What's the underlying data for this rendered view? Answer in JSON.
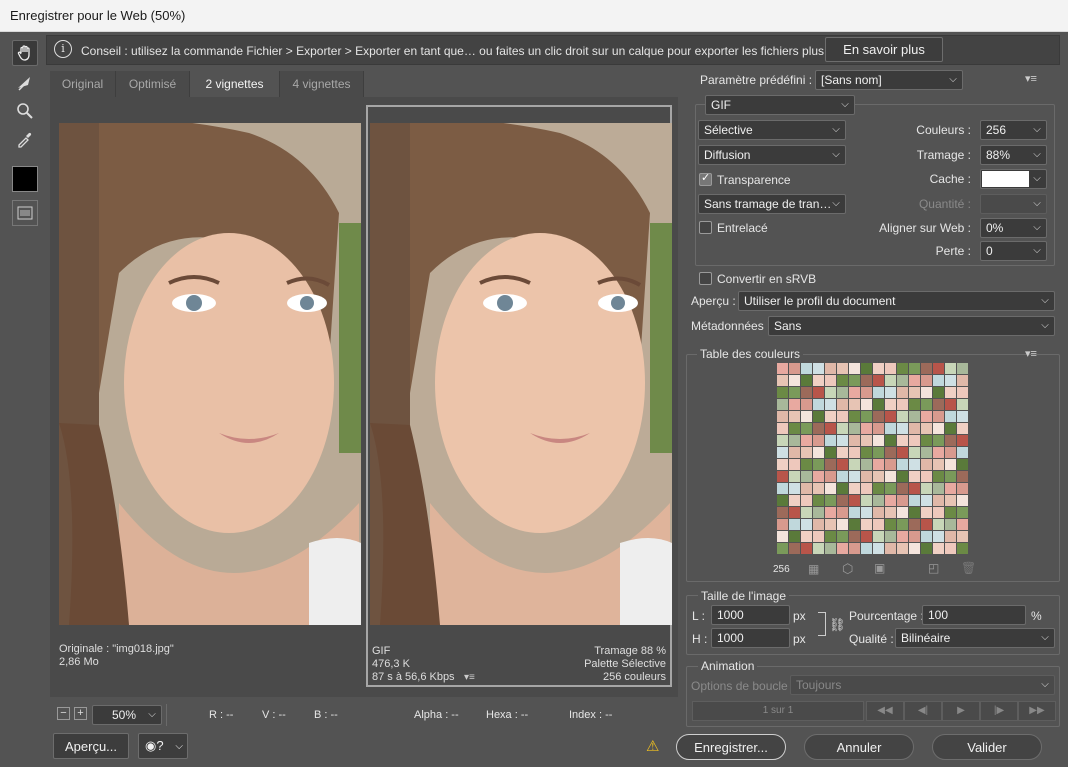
{
  "window": {
    "title": "Enregistrer pour le Web (50%)"
  },
  "info": {
    "text": "Conseil : utilisez la commande Fichier > Exporter > Exporter en tant que… ou faites un clic droit sur un calque pour exporter les fichiers plus rapidement.",
    "button": "En savoir plus"
  },
  "tabs": [
    "Original",
    "Optimisé",
    "2 vignettes",
    "4 vignettes"
  ],
  "original_pane": {
    "line1": "Originale : \"img018.jpg\"",
    "line2": "2,86 Mo"
  },
  "optimized_pane": {
    "format": "GIF",
    "size": "476,3 K",
    "speed": "87 s à 56,6 Kbps",
    "dither": "Tramage 88 %",
    "palette": "Palette Sélective",
    "colors": "256 couleurs"
  },
  "status": {
    "zoom": "50%",
    "r": "R : --",
    "v": "V : --",
    "b": "B : --",
    "alpha": "Alpha : --",
    "hexa": "Hexa : --",
    "index": "Index : --"
  },
  "settings": {
    "preset_label": "Paramètre prédéfini :",
    "preset_value": "[Sans nom]",
    "format": "GIF",
    "reduction": "Sélective",
    "dither_algo": "Diffusion",
    "transparency_label": "Transparence",
    "transparency_dither": "Sans tramage de tran…",
    "interlaced_label": "Entrelacé",
    "colors_label": "Couleurs :",
    "colors_value": "256",
    "dither_label": "Tramage :",
    "dither_value": "88%",
    "matte_label": "Cache :",
    "amount_label": "Quantité :",
    "websnap_label": "Aligner sur Web :",
    "websnap_value": "0%",
    "lossy_label": "Perte :",
    "lossy_value": "0",
    "srgb_label": "Convertir en sRVB",
    "preview_label": "Aperçu :",
    "preview_value": "Utiliser le profil du document",
    "metadata_label": "Métadonnées :",
    "metadata_value": "Sans"
  },
  "color_table": {
    "title": "Table des couleurs",
    "count": "256"
  },
  "image_size": {
    "title": "Taille de l'image",
    "w_label": "L :",
    "w_value": "1000",
    "h_label": "H :",
    "h_value": "1000",
    "unit": "px",
    "percent_label": "Pourcentage :",
    "percent_value": "100",
    "percent_unit": "%",
    "quality_label": "Qualité :",
    "quality_value": "Bilinéaire"
  },
  "animation": {
    "title": "Animation",
    "loop_label": "Options de boucle :",
    "loop_value": "Toujours",
    "frame": "1 sur 1"
  },
  "footer": {
    "preview": "Aperçu...",
    "save": "Enregistrer...",
    "cancel": "Annuler",
    "done": "Valider"
  },
  "palette_colors": [
    "#e8a9a0",
    "#5a7a3a",
    "#c8d6b8",
    "#e7c4b4",
    "#9c6a5a",
    "#cfe0e4",
    "#6b8a45",
    "#d89a8e",
    "#f0d0c4",
    "#a8b89a",
    "#f4e4dc",
    "#b8554a",
    "#e0b8a8",
    "#7a9a5a",
    "#c0d8dc",
    "#eec8bc"
  ]
}
